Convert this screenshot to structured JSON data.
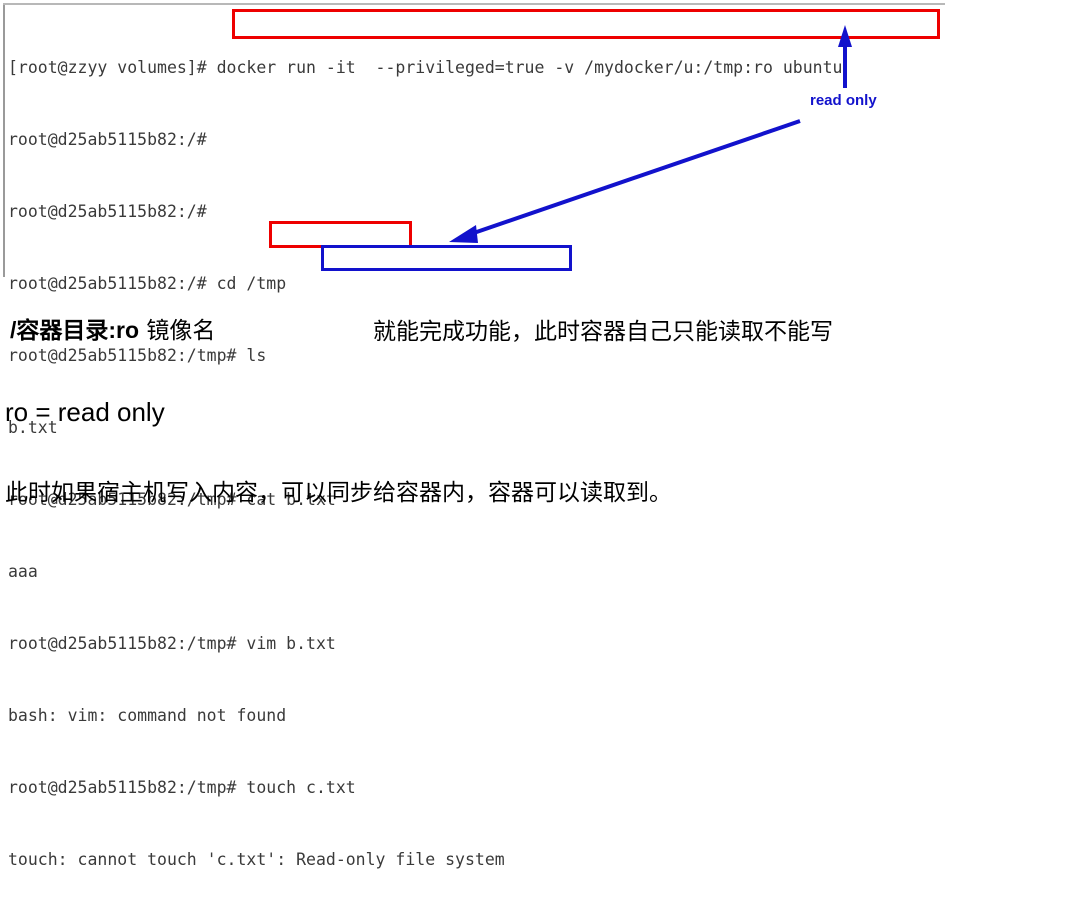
{
  "terminal": {
    "lines": [
      "[root@zzyy volumes]# docker run -it  --privileged=true -v /mydocker/u:/tmp:ro ubuntu",
      "root@d25ab5115b82:/#",
      "root@d25ab5115b82:/#",
      "root@d25ab5115b82:/# cd /tmp",
      "root@d25ab5115b82:/tmp# ls",
      "b.txt",
      "root@d25ab5115b82:/tmp# cat b.txt",
      "aaa",
      "root@d25ab5115b82:/tmp# vim b.txt",
      "bash: vim: command not found",
      "root@d25ab5115b82:/tmp# touch c.txt",
      "touch: cannot touch 'c.txt': Read-only file system"
    ],
    "text_color": "#3a3a3a"
  },
  "annotations": {
    "box_docker_run_label": "docker run -it  --privileged=true -v /mydocker/u:/tmp:ro ubuntu",
    "box_touch_label": "touch c.txt",
    "box_readonly_fs_label": "Read-only file system",
    "read_only_label": "read only",
    "red_color": "#ee0000",
    "blue_color": "#1212cc"
  },
  "notes": {
    "syntax_prefix": "/",
    "syntax_main": "容器目录:ro",
    "syntax_suffix": " 镜像名",
    "effect": "就能完成功能，此时容器自己只能读取不能写",
    "ro_meaning": "ro = read only",
    "host_sync": "此时如果宿主机写入内容，可以同步给容器内，容器可以读取到。"
  }
}
